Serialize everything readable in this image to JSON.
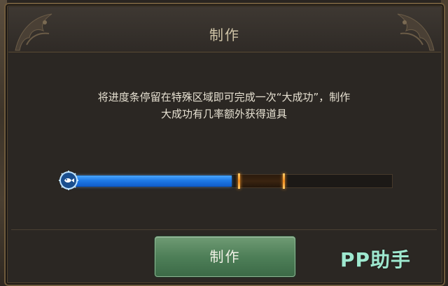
{
  "dialog": {
    "title": "制作",
    "description_line1": "将进度条停留在特殊区域即可完成一次“大成功”，制作",
    "description_line2": "大成功有几率额外获得道具",
    "make_button_label": "制作"
  },
  "progress": {
    "fill_fraction": 0.51,
    "special_zone_start": 0.53,
    "special_zone_end": 0.67
  },
  "watermark": {
    "text": "PP助手"
  },
  "colors": {
    "progress_fill": "#1e7ae6",
    "special_zone_marker": "#f08a1e",
    "button": "#4e7f58",
    "title_text": "#cfc3a6",
    "watermark": "#9ee8cf"
  },
  "icons": {
    "knob": "fish-emblem-icon",
    "corner_ornament": "dragon-ornament-icon"
  }
}
